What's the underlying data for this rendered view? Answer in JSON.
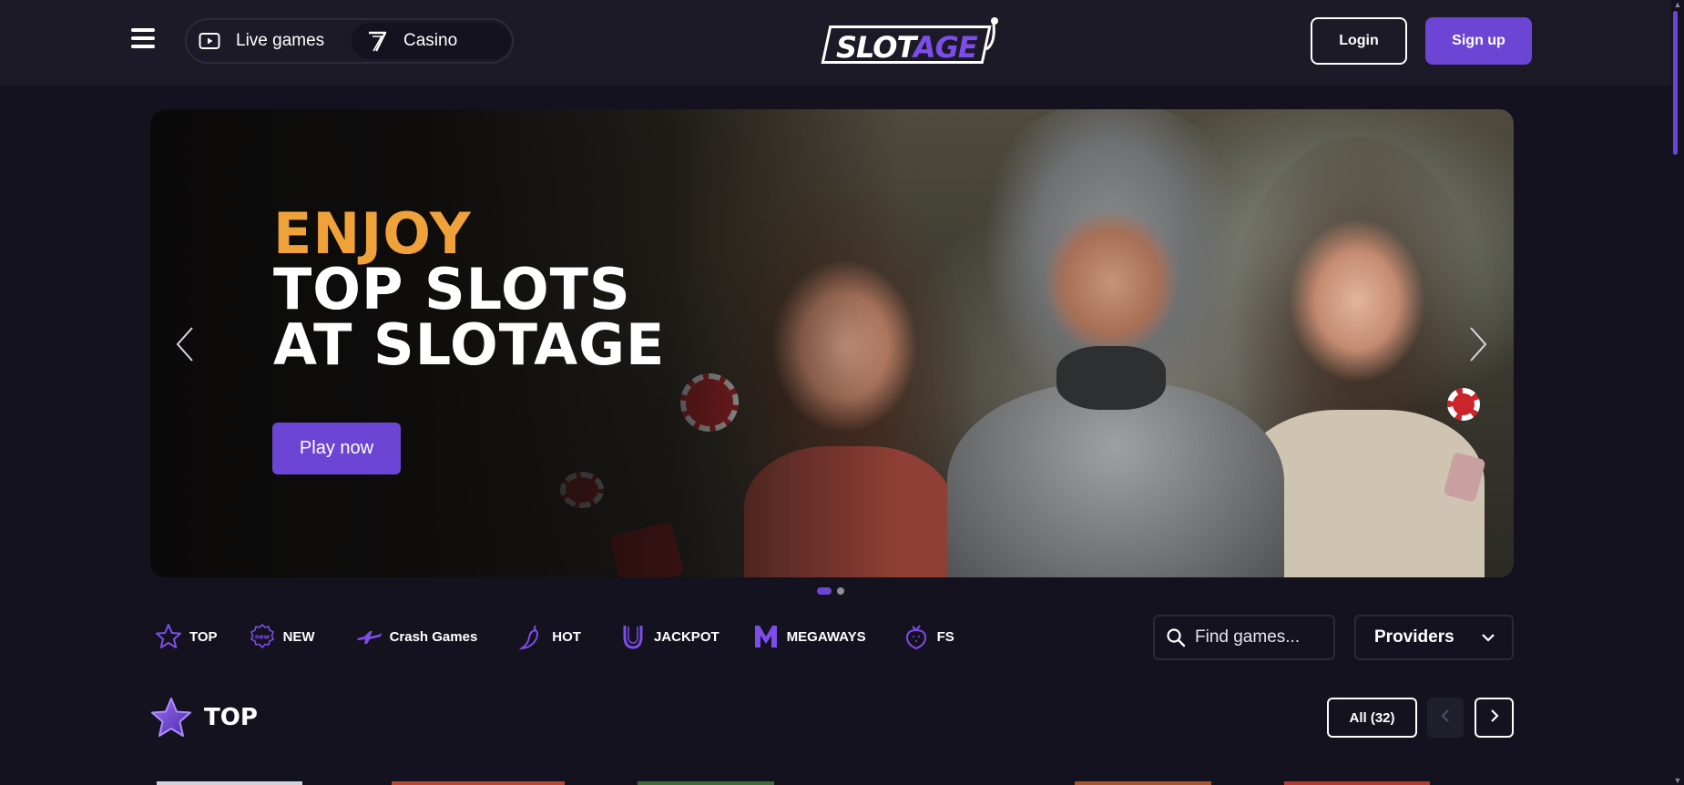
{
  "header": {
    "menu_icon": "hamburger-menu-icon",
    "modes": [
      {
        "label": "Live games",
        "icon": "play-video-icon"
      },
      {
        "label": "Casino",
        "icon": "seven-slot-icon"
      }
    ],
    "logo": {
      "part1": "SLOT",
      "part2": "AGE"
    },
    "login_label": "Login",
    "signup_label": "Sign up"
  },
  "banner": {
    "line1": "ENJOY",
    "line2": "TOP SLOTS",
    "line3": "AT SLOTAGE",
    "cta_label": "Play now",
    "slide_count": 2,
    "active_slide": 1,
    "prev_icon": "chevron-left-icon",
    "next_icon": "chevron-right-icon"
  },
  "categories": [
    {
      "label": "TOP",
      "icon": "star-icon"
    },
    {
      "label": "NEW",
      "icon": "new-badge-icon"
    },
    {
      "label": "Crash Games",
      "icon": "airplane-icon"
    },
    {
      "label": "HOT",
      "icon": "chili-pepper-icon"
    },
    {
      "label": "JACKPOT",
      "icon": "horseshoe-icon"
    },
    {
      "label": "MEGAWAYS",
      "icon": "megaways-m-icon"
    },
    {
      "label": "FS",
      "icon": "strawberry-icon"
    }
  ],
  "search": {
    "placeholder": "Find games...",
    "icon": "search-icon"
  },
  "providers_label": "Providers",
  "section": {
    "title": "TOP",
    "icon": "star-icon",
    "all_label": "All (32)"
  },
  "colors": {
    "background": "#14121f",
    "header": "#1b1a26",
    "accent": "#6c45d4",
    "highlight": "#f0a23a"
  }
}
